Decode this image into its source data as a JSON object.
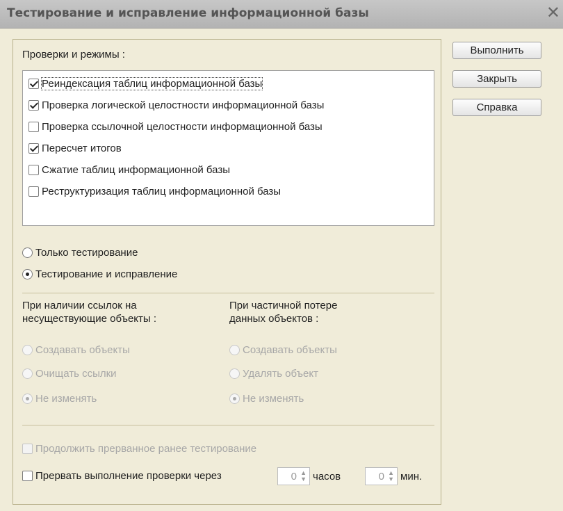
{
  "window": {
    "title": "Тестирование и исправление информационной базы",
    "close_glyph": "✕"
  },
  "checks": {
    "label": "Проверки и режимы :",
    "items": [
      {
        "label": "Реиндексация таблиц информационной базы",
        "checked": true
      },
      {
        "label": "Проверка логической целостности информационной базы",
        "checked": true
      },
      {
        "label": "Проверка ссылочной целостности информационной базы",
        "checked": false
      },
      {
        "label": "Пересчет итогов",
        "checked": true
      },
      {
        "label": "Сжатие таблиц информационной базы",
        "checked": false
      },
      {
        "label": "Реструктуризация таблиц информационной базы",
        "checked": false
      }
    ]
  },
  "mode": {
    "options": [
      {
        "label": "Только тестирование",
        "selected": false
      },
      {
        "label": "Тестирование и исправление",
        "selected": true
      }
    ]
  },
  "missing_refs": {
    "label_line1": "При наличии ссылок на",
    "label_line2": "несуществующие объекты :",
    "options": [
      {
        "label": "Создавать объекты",
        "selected": false
      },
      {
        "label": "Очищать ссылки",
        "selected": false
      },
      {
        "label": "Не изменять",
        "selected": true
      }
    ]
  },
  "partial_loss": {
    "label_line1": "При частичной потере",
    "label_line2": "данных объектов :",
    "options": [
      {
        "label": "Создавать объекты",
        "selected": false
      },
      {
        "label": "Удалять объект",
        "selected": false
      },
      {
        "label": "Не изменять",
        "selected": true
      }
    ]
  },
  "continue": {
    "label": "Продолжить прерванное ранее тестирование",
    "checked": false
  },
  "interrupt": {
    "label": "Прервать выполнение проверки через",
    "hours_value": "0",
    "hours_unit": "часов",
    "minutes_value": "0",
    "minutes_unit": "мин.",
    "checked": false
  },
  "buttons": {
    "run": "Выполнить",
    "close": "Закрыть",
    "help": "Справка"
  }
}
